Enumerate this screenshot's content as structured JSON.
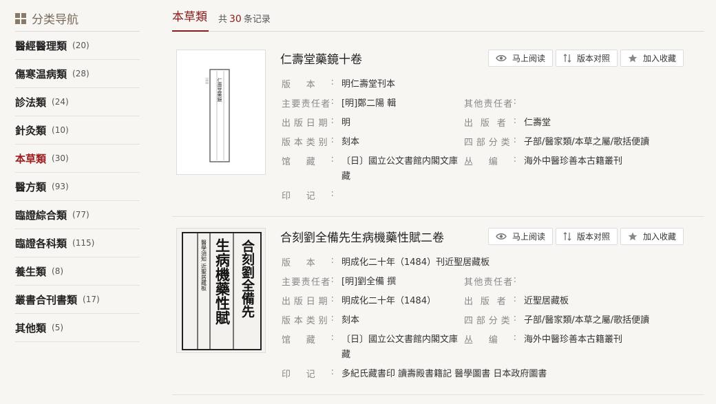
{
  "sidebar": {
    "title": "分类导航",
    "items": [
      {
        "label": "醫經醫理類",
        "count": "(20)"
      },
      {
        "label": "傷寒温病類",
        "count": "(28)"
      },
      {
        "label": "診法類",
        "count": "(24)"
      },
      {
        "label": "針灸類",
        "count": "(10)"
      },
      {
        "label": "本草類",
        "count": "(30)"
      },
      {
        "label": "醫方類",
        "count": "(93)"
      },
      {
        "label": "臨證綜合類",
        "count": "(77)"
      },
      {
        "label": "臨證各科類",
        "count": "(115)"
      },
      {
        "label": "養生類",
        "count": "(8)"
      },
      {
        "label": "叢書合刊書類",
        "count": "(17)"
      },
      {
        "label": "其他類",
        "count": "(5)"
      }
    ],
    "active_index": 4
  },
  "main": {
    "title": "本草類",
    "count_prefix": "共",
    "count": "30",
    "count_suffix": "条记录"
  },
  "actions": {
    "read": "马上阅读",
    "compare": "版本对照",
    "favorite": "加入收藏"
  },
  "labels": {
    "edition": "版本:",
    "responsible": "主要责任者:",
    "other_responsible": "其他责任者:",
    "pub_date": "出版日期:",
    "publisher": "出版者:",
    "edition_type": "版本类别:",
    "classification": "四部分类:",
    "holding": "馆藏:",
    "series": "丛编:",
    "seals": "印记:"
  },
  "records": [
    {
      "title": "仁壽堂藥鏡十卷",
      "edition": "明仁壽堂刊本",
      "responsible": "[明]鄭二陽 輯",
      "other_responsible": "",
      "pub_date": "明",
      "publisher": "仁壽堂",
      "edition_type": "刻本",
      "classification": "子部/醫家類/本草之屬/歌括便讀",
      "holding": "〔日〕國立公文書館内閣文庫藏",
      "series": "海外中醫珍善本古籍叢刊",
      "seals": "",
      "thumb_text": "仁壽堂藥鏡"
    },
    {
      "title": "合刻劉全備先生病機藥性賦二卷",
      "edition": "明成化二十年（1484）刊近聖居藏板",
      "responsible": "[明]劉全備 撰",
      "other_responsible": "",
      "pub_date": "明成化二十年（1484）",
      "publisher": "近聖居藏板",
      "edition_type": "刻本",
      "classification": "子部/醫家類/本草之屬/歌括便讀",
      "holding": "〔日〕國立公文書館内閣文庫藏",
      "series": "海外中醫珍善本古籍叢刊",
      "seals": "多紀氏藏書印 讀壽殿書籍記 醫學圖書 日本政府圖書",
      "thumb_text_right": "合刻劉全備先",
      "thumb_text_mid": "生病機藥性賦",
      "thumb_text_left": "醫學須知 近聖居藏板"
    }
  ],
  "colors": {
    "accent": "#8b1a1a",
    "background": "#f8f6f3"
  }
}
